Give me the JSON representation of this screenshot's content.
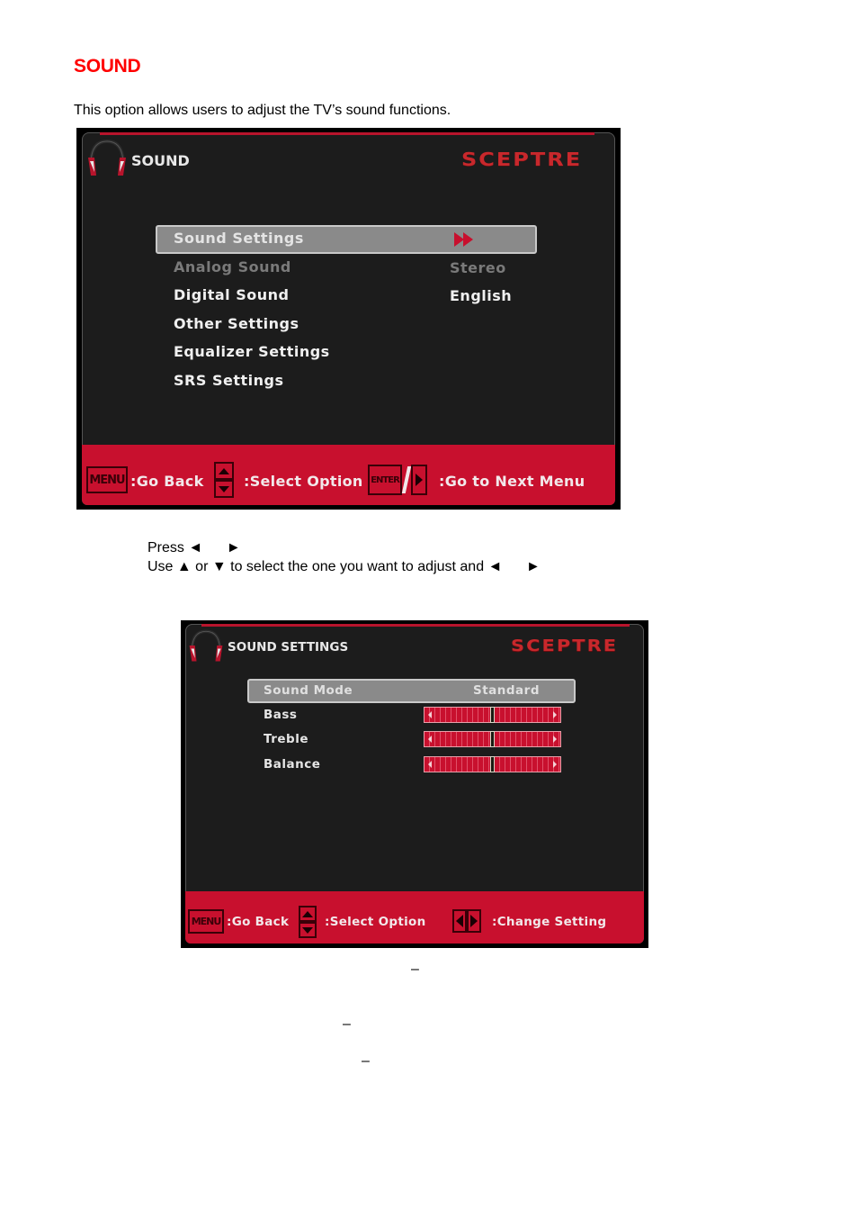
{
  "document": {
    "heading": "SOUND",
    "intro": "This option allows users to adjust the TV’s sound functions.",
    "instructions": [
      "Press ◄      ►",
      "Use ▲ or ▼ to select the one you want to adjust and ◄      ►"
    ],
    "dashes": [
      "–",
      "–",
      "–"
    ]
  },
  "osd_sound": {
    "title": "SOUND",
    "brand": "SCEPTRE",
    "items": [
      {
        "label": "Sound Settings",
        "value": "",
        "state": "selected"
      },
      {
        "label": "Analog Sound",
        "value": "Stereo",
        "state": "disabled"
      },
      {
        "label": "Digital Sound",
        "value": "English",
        "state": "normal"
      },
      {
        "label": "Other Settings",
        "value": "",
        "state": "normal"
      },
      {
        "label": "Equalizer Settings",
        "value": "",
        "state": "normal"
      },
      {
        "label": "SRS Settings",
        "value": "",
        "state": "normal"
      }
    ],
    "selected_icon": "fast-forward-icon",
    "footer": {
      "menu_key": "MENU",
      "go_back": ":Go Back",
      "select_option": ":Select Option",
      "enter_key": "ENTER",
      "next_menu": ":Go to Next Menu"
    }
  },
  "osd_sound_settings": {
    "title": "SOUND SETTINGS",
    "brand": "SCEPTRE",
    "sound_mode": {
      "label": "Sound Mode",
      "value": "Standard"
    },
    "sliders": [
      {
        "label": "Bass",
        "level": 0.5
      },
      {
        "label": "Treble",
        "level": 0.5
      },
      {
        "label": "Balance",
        "level": 0.5
      }
    ],
    "footer": {
      "menu_key": "MENU",
      "go_back": ":Go Back",
      "select_option": ":Select Option",
      "change_setting": ":Change Setting"
    }
  },
  "colors": {
    "heading": "#ff0000",
    "osd_background": "#1c1c1c",
    "osd_footer": "#c8102e",
    "brand": "#c8282c",
    "selection": "#8a8a8a"
  }
}
